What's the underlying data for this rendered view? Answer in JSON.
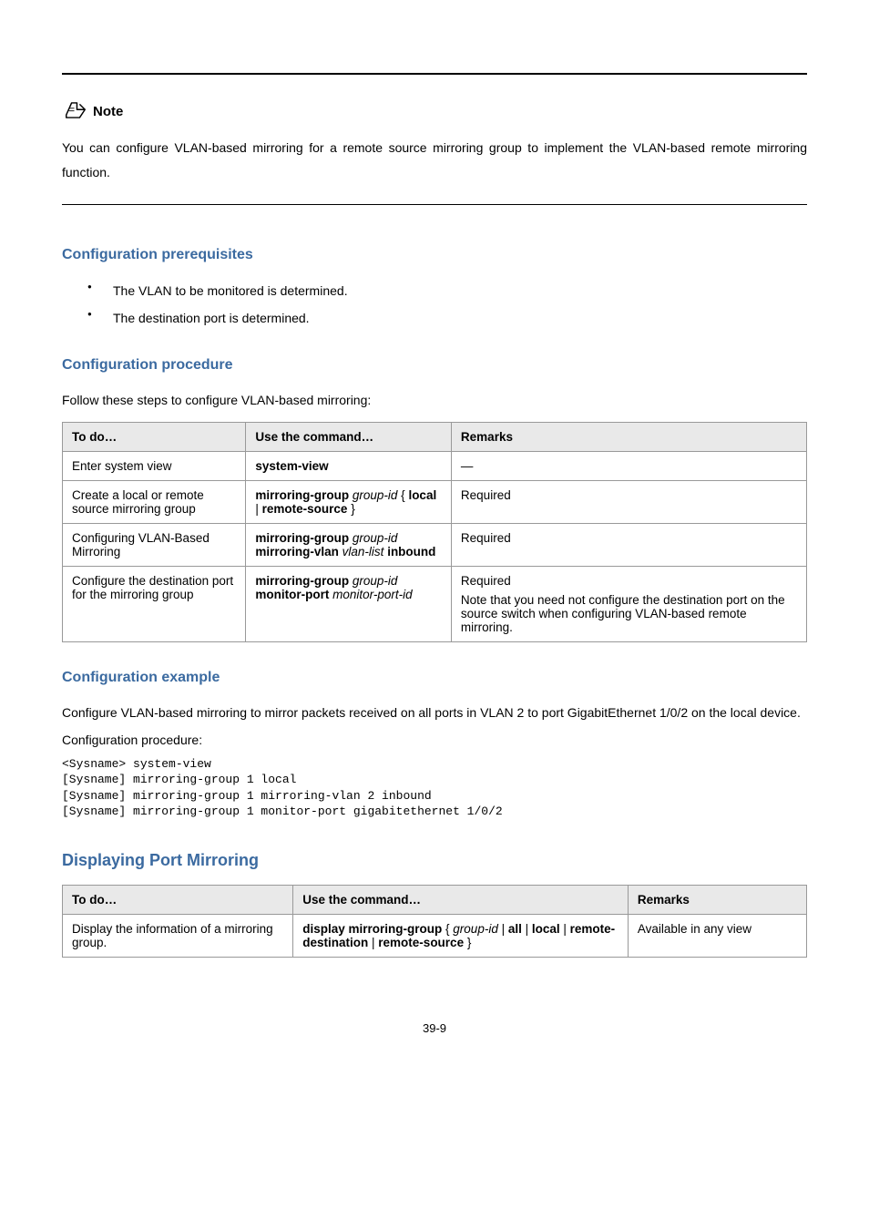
{
  "note": {
    "label": "Note",
    "body": "You can configure VLAN-based mirroring for a remote source mirroring group to implement the VLAN-based remote mirroring function."
  },
  "prereq": {
    "heading": "Configuration prerequisites",
    "items": [
      "The VLAN to be monitored is determined.",
      "The destination port is determined."
    ]
  },
  "proc": {
    "heading": "Configuration procedure",
    "lead": "Follow these steps to configure VLAN-based mirroring:",
    "headers": [
      "To do…",
      "Use the command…",
      "Remarks"
    ],
    "rows": [
      {
        "to": "Enter system view",
        "cmd": "system-view",
        "rem": "—"
      },
      {
        "to": "Create a local or remote source mirroring group",
        "cmd_html": "<span class='cmd'>mirroring-group</span> <span class='ital'>group-id</span> { <span class='cmd'>local</span> | <span class='cmd'>remote-source</span> }",
        "rem": "Required"
      },
      {
        "to": "Configuring VLAN-Based Mirroring",
        "cmd_html": "<span class='cmd'>mirroring-group</span> <span class='ital'>group-id</span> <span class='cmd'>mirroring-vlan</span> <span class='ital'>vlan-list</span> <span class='cmd'>inbound</span>",
        "rem": "Required"
      },
      {
        "to": "Configure the destination port for the mirroring group",
        "cmd_html": "<span class='cmd'>mirroring-group</span> <span class='ital'>group-id</span> <span class='cmd'>monitor-port</span> <span class='ital'>monitor-port-id</span>",
        "rem_html": "Required<br><span style='display:inline-block;margin-top:6px;'>Note that you need not configure the destination port on the source switch when configuring VLAN-based remote mirroring.</span>"
      }
    ]
  },
  "example": {
    "heading": "Configuration example",
    "body": "Configure VLAN-based mirroring to mirror packets received on all ports in VLAN 2 to port GigabitEthernet 1/0/2 on the local device.",
    "cfg_label": "Configuration procedure:",
    "code": "<Sysname> system-view\n[Sysname] mirroring-group 1 local\n[Sysname] mirroring-group 1 mirroring-vlan 2 inbound\n[Sysname] mirroring-group 1 monitor-port gigabitethernet 1/0/2"
  },
  "display": {
    "heading": "Displaying Port Mirroring",
    "headers": [
      "To do…",
      "Use the command…",
      "Remarks"
    ],
    "row": {
      "to": "Display the information of a mirroring group.",
      "cmd_html": "<span class='cmd'>display mirroring-group</span> { <span class='ital'>group-id</span> | <span class='cmd'>all</span> | <span class='cmd'>local</span> | <span class='cmd'>remote-destination</span> | <span class='cmd'>remote-source</span> }",
      "rem": "Available in any view"
    }
  },
  "page": "39-9"
}
